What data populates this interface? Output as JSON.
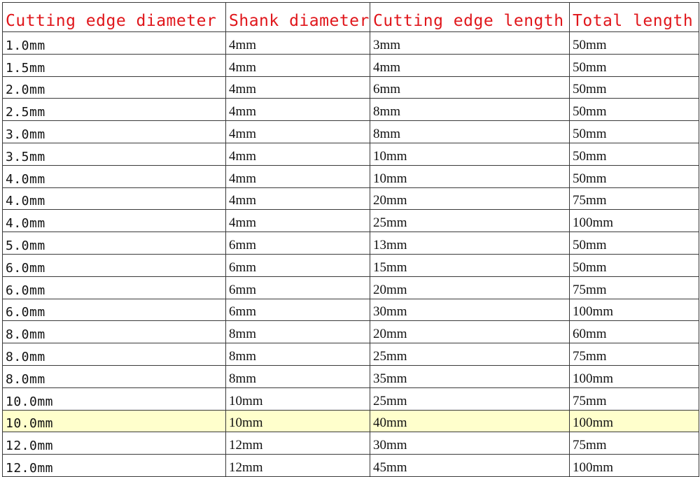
{
  "table": {
    "headers": [
      "Cutting edge diameter",
      "Shank diameter",
      "Cutting edge length",
      "Total length"
    ],
    "rows": [
      [
        "1.0mm",
        "4mm",
        "3mm",
        "50mm"
      ],
      [
        "1.5mm",
        "4mm",
        "4mm",
        "50mm"
      ],
      [
        "2.0mm",
        "4mm",
        "6mm",
        "50mm"
      ],
      [
        "2.5mm",
        "4mm",
        "8mm",
        "50mm"
      ],
      [
        "3.0mm",
        "4mm",
        "8mm",
        "50mm"
      ],
      [
        "3.5mm",
        "4mm",
        "10mm",
        "50mm"
      ],
      [
        "4.0mm",
        "4mm",
        "10mm",
        "50mm"
      ],
      [
        "4.0mm",
        "4mm",
        "20mm",
        "75mm"
      ],
      [
        "4.0mm",
        "4mm",
        "25mm",
        "100mm"
      ],
      [
        "5.0mm",
        "6mm",
        "13mm",
        "50mm"
      ],
      [
        "6.0mm",
        "6mm",
        "15mm",
        "50mm"
      ],
      [
        "6.0mm",
        "6mm",
        "20mm",
        "75mm"
      ],
      [
        "6.0mm",
        "6mm",
        "30mm",
        "100mm"
      ],
      [
        "8.0mm",
        "8mm",
        "20mm",
        "60mm"
      ],
      [
        "8.0mm",
        "8mm",
        "25mm",
        "75mm"
      ],
      [
        "8.0mm",
        "8mm",
        "35mm",
        "100mm"
      ],
      [
        "10.0mm",
        "10mm",
        "25mm",
        "75mm"
      ],
      [
        "10.0mm",
        "10mm",
        "40mm",
        "100mm"
      ],
      [
        "12.0mm",
        "12mm",
        "30mm",
        "75mm"
      ],
      [
        "12.0mm",
        "12mm",
        "45mm",
        "100mm"
      ]
    ],
    "highlighted_row": 17
  },
  "colors": {
    "header_text": "#e0161b",
    "cell_text": "#111111",
    "grid": "#3a3a3a",
    "highlight_fill": "#ffffcc"
  }
}
